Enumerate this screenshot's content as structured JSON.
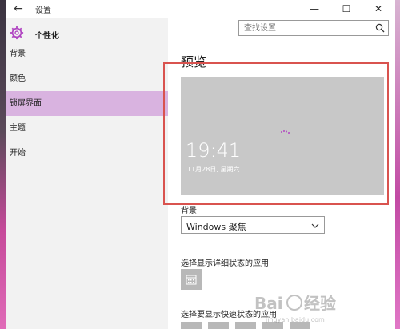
{
  "window": {
    "title": "设置",
    "back_glyph": "←",
    "min_glyph": "—",
    "max_glyph": "☐",
    "close_glyph": "✕"
  },
  "sidebar": {
    "title": "个性化",
    "items": [
      {
        "label": "背景"
      },
      {
        "label": "颜色"
      },
      {
        "label": "锁屏界面",
        "active": true
      },
      {
        "label": "主题"
      },
      {
        "label": "开始"
      }
    ]
  },
  "search": {
    "placeholder": "查找设置"
  },
  "main": {
    "preview_heading": "预览",
    "clock_time": "19:41",
    "clock_date": "11月28日, 星期六",
    "background_label": "背景",
    "background_value": "Windows 聚焦",
    "detail_status_label": "选择显示详细状态的应用",
    "quick_status_label": "选择要显示快速状态的应用"
  },
  "colors": {
    "accent": "#b146c2",
    "active_nav": "#d9b3e0",
    "highlight_frame": "#d9534f",
    "preview_bg": "#c8c8c8"
  }
}
